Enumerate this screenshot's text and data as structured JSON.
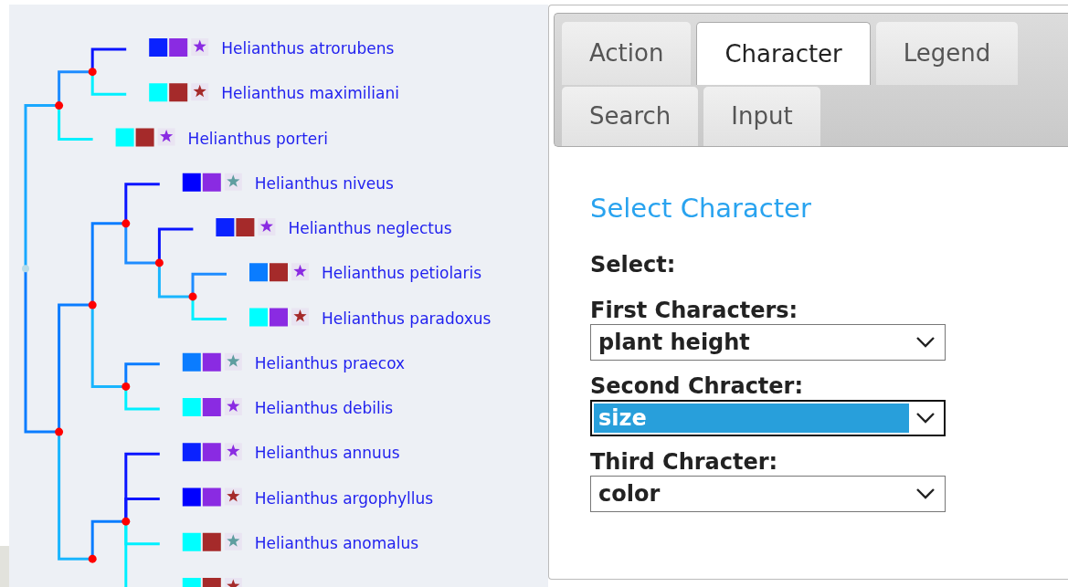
{
  "tree": {
    "root": {
      "children": [
        {
          "color": "#19a8ff",
          "children": [
            {
              "color": "#1e8cff",
              "children": [
                {
                  "name": "Helianthus atrorubens",
                  "color": "#0a14ff",
                  "traits": [
                    {
                      "color": "#0a22ff"
                    },
                    {
                      "color": "#8a2be2"
                    }
                  ],
                  "star": {
                    "color": "#8a2be2"
                  }
                },
                {
                  "name": "Helianthus maximiliani",
                  "color": "#00f0ff",
                  "traits": [
                    {
                      "color": "#00ffff"
                    },
                    {
                      "color": "#a52a2a"
                    }
                  ],
                  "star": {
                    "color": "#a52a2a"
                  }
                }
              ]
            },
            {
              "name": "Helianthus porteri",
              "color": "#00f0ff",
              "traits": [
                {
                  "color": "#00ffff"
                },
                {
                  "color": "#a52a2a"
                }
              ],
              "star": {
                "color": "#8a2be2"
              }
            }
          ]
        },
        {
          "color": "#0a7cff",
          "children": [
            {
              "color": "#0a7cff",
              "children": [
                {
                  "color": "#0a7cff",
                  "children": [
                    {
                      "name": "Helianthus niveus",
                      "color": "#0a14ff",
                      "traits": [
                        {
                          "color": "#0000ff"
                        },
                        {
                          "color": "#8a2be2"
                        }
                      ],
                      "star": {
                        "color": "#5f9ea0"
                      }
                    },
                    {
                      "color": "#1e8cff",
                      "children": [
                        {
                          "name": "Helianthus neglectus",
                          "color": "#0a14ff",
                          "traits": [
                            {
                              "color": "#0a22ff"
                            },
                            {
                              "color": "#a52a2a"
                            }
                          ],
                          "star": {
                            "color": "#8a2be2"
                          }
                        },
                        {
                          "color": "#19b5fe",
                          "children": [
                            {
                              "name": "Helianthus petiolaris",
                              "color": "#1e8cff",
                              "traits": [
                                {
                                  "color": "#0a7cff"
                                },
                                {
                                  "color": "#a52a2a"
                                }
                              ],
                              "star": {
                                "color": "#8a2be2"
                              }
                            },
                            {
                              "name": "Helianthus paradoxus",
                              "color": "#00f0ff",
                              "traits": [
                                {
                                  "color": "#00ffff"
                                },
                                {
                                  "color": "#8a2be2"
                                }
                              ],
                              "star": {
                                "color": "#a52a2a"
                              }
                            }
                          ]
                        }
                      ]
                    }
                  ]
                },
                {
                  "color": "#19b5fe",
                  "children": [
                    {
                      "name": "Helianthus praecox",
                      "color": "#0a7cff",
                      "traits": [
                        {
                          "color": "#0a7cff"
                        },
                        {
                          "color": "#8a2be2"
                        }
                      ],
                      "star": {
                        "color": "#5f9ea0"
                      }
                    },
                    {
                      "name": "Helianthus debilis",
                      "color": "#00f0ff",
                      "traits": [
                        {
                          "color": "#00ffff"
                        },
                        {
                          "color": "#8a2be2"
                        }
                      ],
                      "star": {
                        "color": "#8a2be2"
                      }
                    }
                  ]
                }
              ]
            },
            {
              "color": "#19b5fe",
              "continues": true,
              "children": [
                {
                  "color": "#0a7cff",
                  "children": [
                    {
                      "name": "Helianthus annuus",
                      "color": "#0a14ff",
                      "traits": [
                        {
                          "color": "#0a22ff"
                        },
                        {
                          "color": "#8a2be2"
                        }
                      ],
                      "star": {
                        "color": "#8a2be2"
                      }
                    },
                    {
                      "name": "Helianthus argophyllus",
                      "color": "#0a14ff",
                      "traits": [
                        {
                          "color": "#0000ff"
                        },
                        {
                          "color": "#8a2be2"
                        }
                      ],
                      "star": {
                        "color": "#a52a2a"
                      }
                    },
                    {
                      "name": "Helianthus anomalus",
                      "color": "#00f0ff",
                      "traits": [
                        {
                          "color": "#00ffff"
                        },
                        {
                          "color": "#a52a2a"
                        }
                      ],
                      "star": {
                        "color": "#5f9ea0"
                      }
                    },
                    {
                      "color": "#00f0ff",
                      "traits": [
                        {
                          "color": "#00ffff"
                        },
                        {
                          "color": "#a52a2a"
                        }
                      ],
                      "star": {
                        "color": "#a52a2a"
                      }
                    }
                  ]
                }
              ]
            }
          ]
        }
      ]
    }
  },
  "tabs": [
    {
      "label": "Action",
      "selected": false
    },
    {
      "label": "Character",
      "selected": true
    },
    {
      "label": "Legend",
      "selected": false
    },
    {
      "label": "Search",
      "selected": false
    },
    {
      "label": "Input",
      "selected": false
    }
  ],
  "panel": {
    "title": "Select Character",
    "select_label": "Select:",
    "selects": [
      {
        "label": "First Characters:",
        "value": "plant height",
        "focused": false
      },
      {
        "label": "Second Chracter:",
        "value": "size",
        "focused": true
      },
      {
        "label": "Third Chracter:",
        "value": "color",
        "focused": false
      }
    ]
  }
}
